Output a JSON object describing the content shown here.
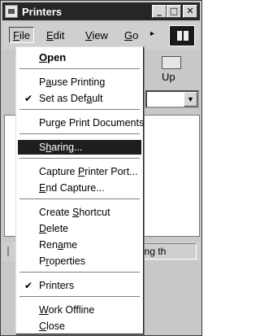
{
  "window": {
    "title": "Printers"
  },
  "menubar": {
    "items": [
      "File",
      "Edit",
      "View",
      "Go"
    ],
    "underline": [
      "F",
      "E",
      "V",
      "G"
    ],
    "chevron": "▸"
  },
  "title_buttons": {
    "minimize": "_",
    "maximize": "□",
    "close": "✕"
  },
  "toolbar": {
    "up_label": "Up"
  },
  "status": {
    "text": "ing th"
  },
  "file_menu": {
    "open": "Open",
    "pause_printing": "Pause Printing",
    "set_as_default": "Set as Default",
    "set_as_default_checked": true,
    "purge": "Purge Print Documents",
    "sharing": "Sharing...",
    "capture_port": "Capture Printer Port...",
    "end_capture": "End Capture...",
    "create_shortcut": "Create Shortcut",
    "delete": "Delete",
    "rename": "Rename",
    "properties": "Properties",
    "printers": "Printers",
    "printers_checked": true,
    "work_offline": "Work Offline",
    "close": "Close",
    "check_glyph": "✔"
  },
  "colors": {
    "title_bg": "#262626",
    "highlight": "#1e1e1e",
    "menu_bg": "#ffffff"
  }
}
